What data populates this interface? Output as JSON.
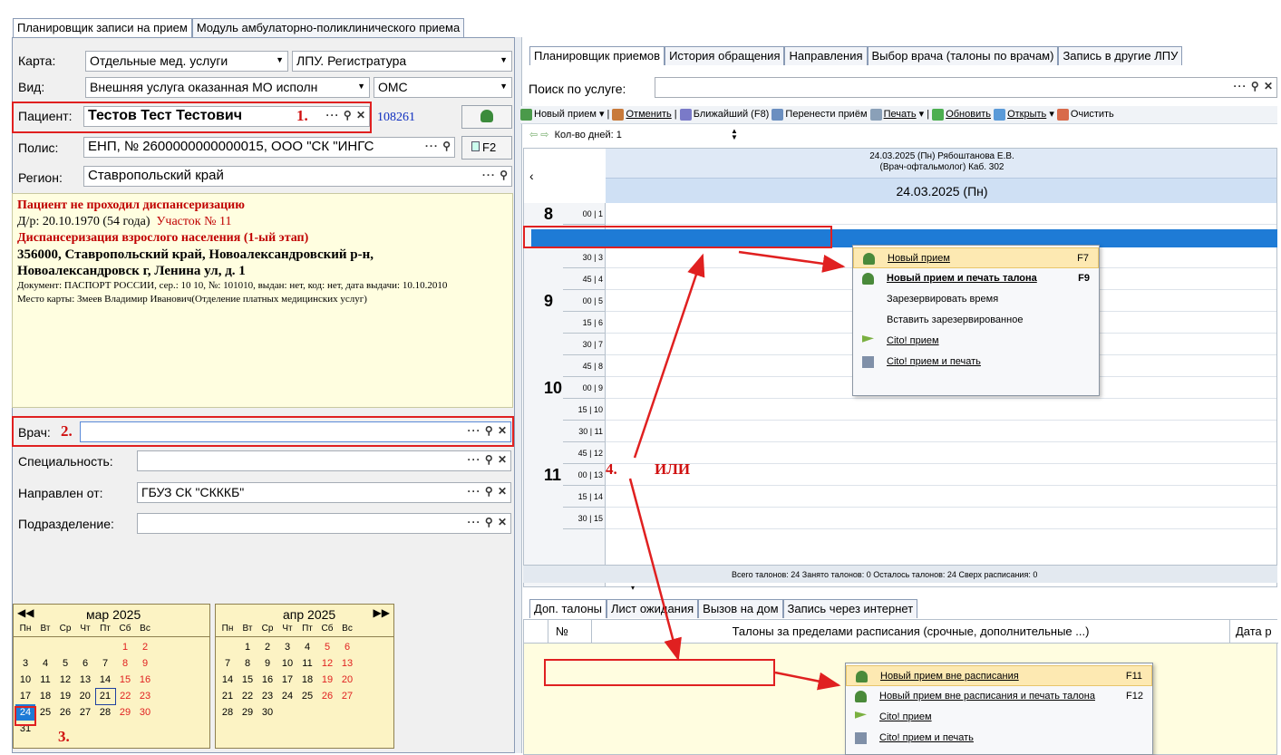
{
  "left_tabs": [
    "Планировщик записи на прием",
    "Модуль амбулаторно-поликлинического приема"
  ],
  "form": {
    "karta_label": "Карта:",
    "karta_value": "Отдельные мед. услуги",
    "lpu_value": "ЛПУ. Регистратура",
    "vid_label": "Вид:",
    "vid_value": "Внешняя услуга оказанная МО исполн",
    "oms_value": "ОМС",
    "patient_label": "Пациент:",
    "patient_value": "Тестов Тест Тестович",
    "patient_id": "108261",
    "polis_label": "Полис:",
    "polis_value": "ЕНП, № 2600000000000015, ООО \"СК \"ИНГС",
    "f2_label": "F2",
    "region_label": "Регион:",
    "region_value": "Ставропольский край",
    "vrach_label": "Врач:",
    "spec_label": "Специальность:",
    "napr_label": "Направлен от:",
    "napr_value": "ГБУЗ СК \"СКККБ\"",
    "podr_label": "Подразделение:"
  },
  "steps": {
    "s1": "1.",
    "s2": "2.",
    "s3": "3.",
    "s4": "4.",
    "ili": "ИЛИ"
  },
  "info": {
    "l1": "Пациент не проходил диспансеризацию",
    "l2a": "Д/р: 20.10.1970 (54 года)",
    "l2b": "Участок № 11",
    "l3": "Диспансеризация взрослого населения (1-ый этап)",
    "l4": "356000, Ставропольский край, Новоалександровский р-н,",
    "l5": "Новоалександровск г, Ленина ул, д. 1",
    "l6": "Документ: ПАСПОРТ РОССИИ, сер.: 10 10, №: 101010, выдан: нет, код: нет, дата выдачи: 10.10.2010",
    "l7": "Место карты: Змеев Владимир Иванович(Отделение платных медицинских услуг)"
  },
  "calendar": {
    "mar_title": "мар 2025",
    "apr_title": "апр 2025",
    "days": [
      "Пн",
      "Вт",
      "Ср",
      "Чт",
      "Пт",
      "Сб",
      "Вс"
    ],
    "mar": [
      [
        "",
        "",
        "",
        "",
        "",
        "1",
        "2"
      ],
      [
        "3",
        "4",
        "5",
        "6",
        "7",
        "8",
        "9"
      ],
      [
        "10",
        "11",
        "12",
        "13",
        "14",
        "15",
        "16"
      ],
      [
        "17",
        "18",
        "19",
        "20",
        "21",
        "22",
        "23"
      ],
      [
        "24",
        "25",
        "26",
        "27",
        "28",
        "29",
        "30"
      ],
      [
        "31",
        "",
        "",
        "",
        "",
        "",
        ""
      ]
    ],
    "apr": [
      [
        "",
        "1",
        "2",
        "3",
        "4",
        "5",
        "6"
      ],
      [
        "7",
        "8",
        "9",
        "10",
        "11",
        "12",
        "13"
      ],
      [
        "14",
        "15",
        "16",
        "17",
        "18",
        "19",
        "20"
      ],
      [
        "21",
        "22",
        "23",
        "24",
        "25",
        "26",
        "27"
      ],
      [
        "28",
        "29",
        "30",
        "",
        "",
        "",
        ""
      ]
    ],
    "today": "21",
    "selected": "24"
  },
  "right_tabs": [
    "Планировщик приемов",
    "История обращения",
    "Направления",
    "Выбор врача (талоны по врачам)",
    "Запись в другие ЛПУ"
  ],
  "search_label": "Поиск по услуге:",
  "toolbar": [
    "Новый прием",
    "Отменить",
    "Ближайший (F8)",
    "Перенести приём",
    "Печать",
    "Обновить",
    "Открыть",
    "Очистить"
  ],
  "days_label": "Кол-во дней:",
  "days_value": "1",
  "sched": {
    "header1": "24.03.2025 (Пн) Рябоштанова Е.В.",
    "header2": "(Врач-офтальмолог) Каб. 302",
    "date": "24.03.2025 (Пн)",
    "hours": [
      "8",
      "9",
      "10",
      "11"
    ],
    "rows": [
      "00 | 1",
      "15 | 2",
      "30 | 3",
      "45 | 4",
      "00 | 5",
      "15 | 6",
      "30 | 7",
      "45 | 8",
      "00 | 9",
      "15 | 10",
      "30 | 11",
      "45 | 12",
      "00 | 13",
      "15 | 14",
      "30 | 15"
    ],
    "status": "Всего талонов: 24  Занято талонов: 0  Осталось талонов: 24  Сверх расписания: 0"
  },
  "menu1": [
    {
      "label": "Новый прием",
      "sc": "F7"
    },
    {
      "label": "Новый прием и печать талона",
      "sc": "F9"
    },
    {
      "label": "Зарезервировать время",
      "sc": ""
    },
    {
      "label": "Вставить зарезервированное",
      "sc": ""
    },
    {
      "label": "Cito! прием",
      "sc": ""
    },
    {
      "label": "Cito! прием и печать",
      "sc": ""
    }
  ],
  "bottom_tabs": [
    "Доп. талоны",
    "Лист ожидания",
    "Вызов на дом",
    "Запись через интернет"
  ],
  "bottom_grid": {
    "col1": "№",
    "col2": "Талоны за пределами расписания (срочные, дополнительные ...)",
    "col3": "Дата р"
  },
  "menu2": [
    {
      "label": "Новый прием вне расписания",
      "sc": "F11"
    },
    {
      "label": "Новый прием вне расписания и печать талона",
      "sc": "F12"
    },
    {
      "label": "Cito! прием",
      "sc": ""
    },
    {
      "label": "Cito! прием и печать",
      "sc": ""
    }
  ]
}
